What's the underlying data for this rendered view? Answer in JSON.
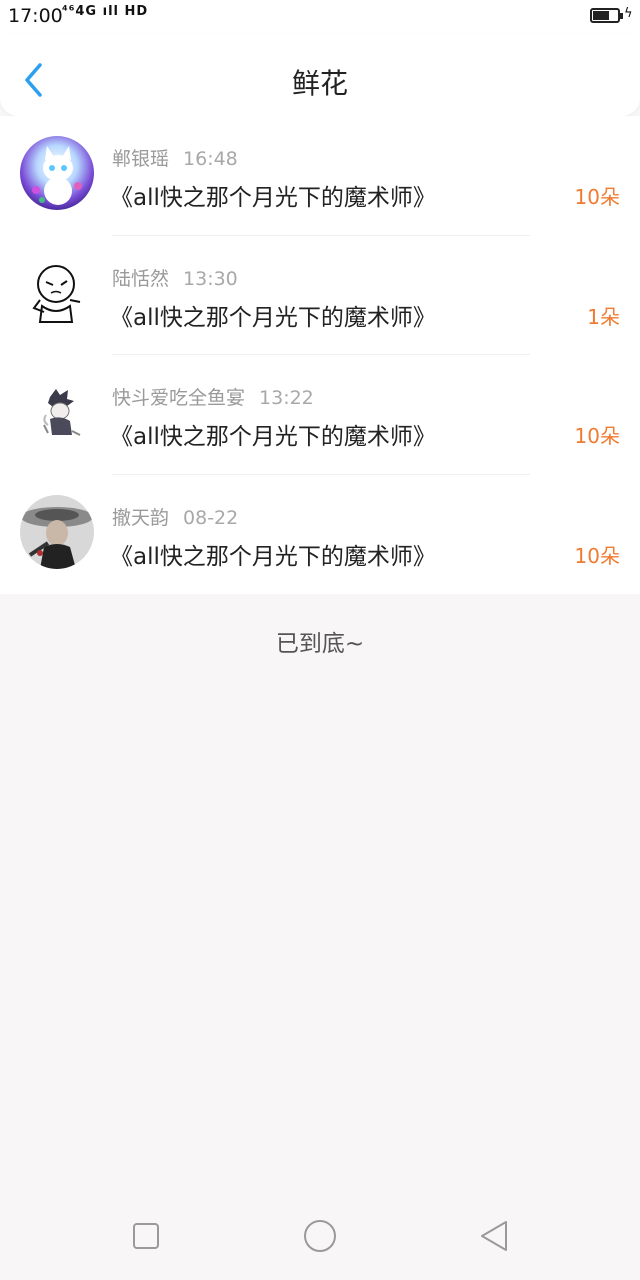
{
  "status_bar": {
    "time": "17:00",
    "signal": "⁴⁶4G ıll HD"
  },
  "header": {
    "title": "鲜花"
  },
  "entries": [
    {
      "user": "郸银瑶",
      "time": "16:48",
      "work": "《all快之那个月光下的魔术师》",
      "count": "10朵"
    },
    {
      "user": "陆恬然",
      "time": "13:30",
      "work": "《all快之那个月光下的魔术师》",
      "count": "1朵"
    },
    {
      "user": "快斗爱吃全鱼宴",
      "time": "13:22",
      "work": "《all快之那个月光下的魔术师》",
      "count": "10朵"
    },
    {
      "user": "撤天韵",
      "time": "08-22",
      "work": "《all快之那个月光下的魔术师》",
      "count": "10朵"
    }
  ],
  "footer": {
    "end_text": "已到底~"
  },
  "colors": {
    "accent_orange": "#f07a2f",
    "back_blue": "#2b9ff0",
    "background": "#f8f6f7"
  }
}
